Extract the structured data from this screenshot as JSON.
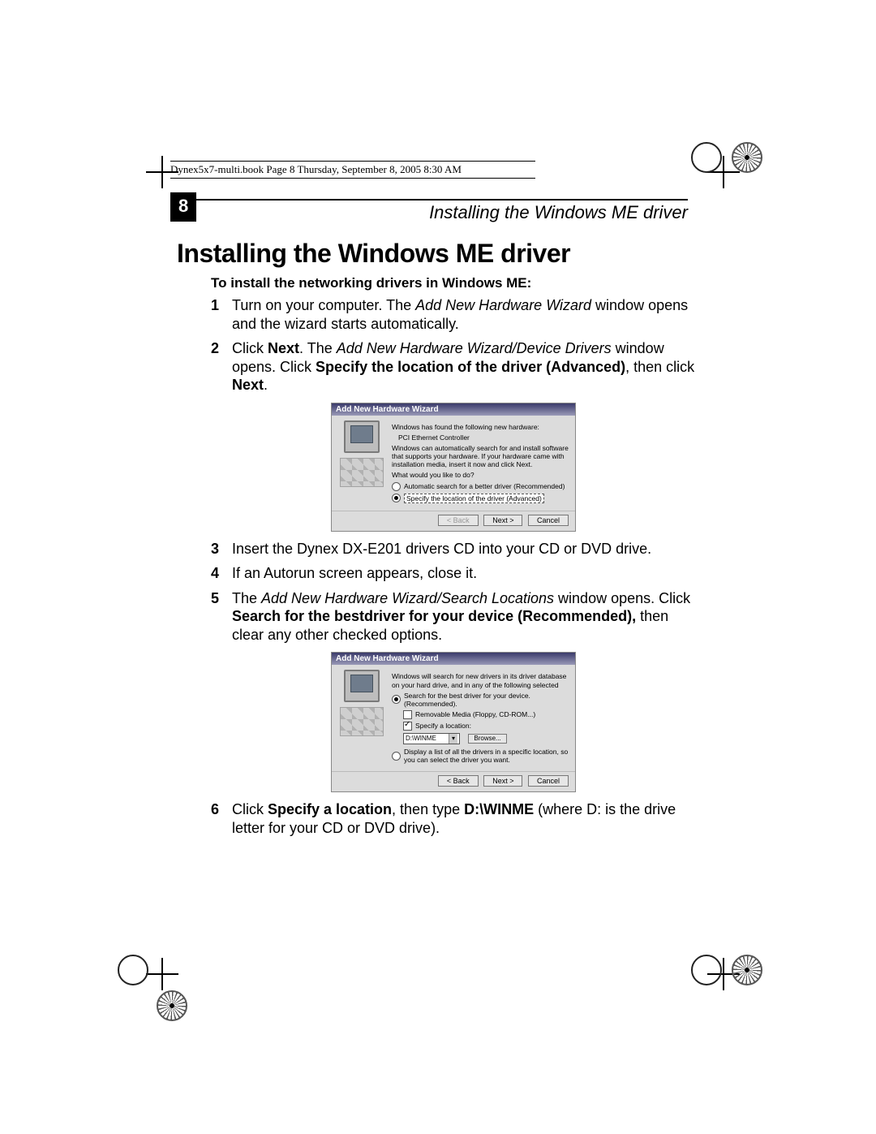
{
  "book_header": "Dynex5x7-multi.book  Page 8  Thursday, September 8, 2005  8:30 AM",
  "running_head": {
    "page_number": "8",
    "title": "Installing the Windows ME driver"
  },
  "heading": "Installing the Windows ME driver",
  "subhead": "To install the networking drivers in Windows ME:",
  "steps": {
    "s1": {
      "num": "1",
      "t1": "Turn on your computer. The ",
      "i1": "Add New Hardware Wizard",
      "t2": " window opens and the wizard starts automatically."
    },
    "s2": {
      "num": "2",
      "t1": "Click ",
      "b1": "Next",
      "t2": ". The ",
      "i1": "Add New Hardware Wizard/Device Drivers",
      "t3": " window opens. Click ",
      "b2": "Specify the location of the driver (Advanced)",
      "t4": ", then click ",
      "b3": "Next",
      "t5": "."
    },
    "s3": {
      "num": "3",
      "t1": "Insert the Dynex DX-E201 drivers CD into your CD or DVD drive."
    },
    "s4": {
      "num": "4",
      "t1": "If an Autorun screen appears, close it."
    },
    "s5": {
      "num": "5",
      "t1": "The ",
      "i1": "Add New Hardware Wizard/Search Locations",
      "t2": " window opens. Click ",
      "b1": "Search for the bestdriver for your device (Recommended),",
      "t3": " then clear any other checked options."
    },
    "s6": {
      "num": "6",
      "t1": "Click ",
      "b1": "Specify a location",
      "t2": ", then type ",
      "b2": "D:\\WINME",
      "t3": " (where D: is the drive letter for your CD or DVD drive)."
    }
  },
  "wizard1": {
    "title": "Add New Hardware Wizard",
    "line1": "Windows has found the following new hardware:",
    "device": "PCI Ethernet Controller",
    "line2": "Windows can automatically search for and install software that supports your hardware. If your hardware came with installation media, insert it now and click Next.",
    "prompt": "What would you like to do?",
    "opt1": "Automatic search for a better driver (Recommended)",
    "opt2": "Specify the location of the driver (Advanced)",
    "back": "< Back",
    "next": "Next >",
    "cancel": "Cancel"
  },
  "wizard2": {
    "title": "Add New Hardware Wizard",
    "line1": "Windows will search for new drivers in its driver database on your hard drive, and in any of the following selected",
    "opt1": "Search for the best driver for your device. (Recommended).",
    "opt1a": "Removable Media (Floppy, CD-ROM...)",
    "opt1b": "Specify a location:",
    "path": "D:\\WINME",
    "browse": "Browse...",
    "opt2": "Display a list of all the drivers in a specific location, so you can select the driver you want.",
    "back": "< Back",
    "next": "Next >",
    "cancel": "Cancel"
  }
}
